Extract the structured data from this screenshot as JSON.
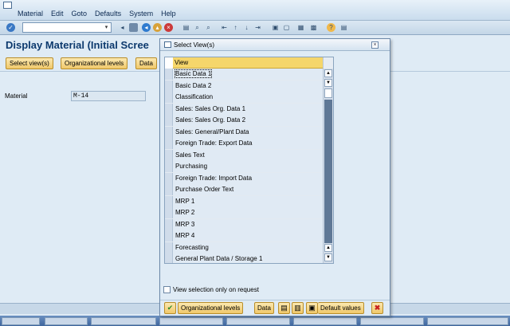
{
  "menu": [
    "Material",
    "Edit",
    "Goto",
    "Defaults",
    "System",
    "Help"
  ],
  "page": {
    "title": "Display Material (Initial Scree"
  },
  "app_toolbar": {
    "select_views": "Select view(s)",
    "org_levels": "Organizational levels",
    "data": "Data"
  },
  "form": {
    "material_label": "Material",
    "material_value": "M-14"
  },
  "dialog": {
    "title": "Select View(s)",
    "column_header": "View",
    "views": [
      "Basic Data 1",
      "Basic Data 2",
      "Classification",
      "Sales: Sales Org. Data 1",
      "Sales: Sales Org. Data 2",
      "Sales: General/Plant Data",
      "Foreign Trade: Export Data",
      "Sales Text",
      "Purchasing",
      "Foreign Trade: Import Data",
      "Purchase Order Text",
      "MRP 1",
      "MRP 2",
      "MRP 3",
      "MRP 4",
      "Forecasting",
      "General Plant Data / Storage 1"
    ],
    "view_selection_label": "View selection only on request",
    "footer": {
      "org_levels": "Organizational levels",
      "data": "Data",
      "default_values": "Default values"
    }
  },
  "colors": {
    "button_accent": "#f0c86a",
    "header_accent": "#f5d66b",
    "title_color": "#0d3a6e"
  }
}
